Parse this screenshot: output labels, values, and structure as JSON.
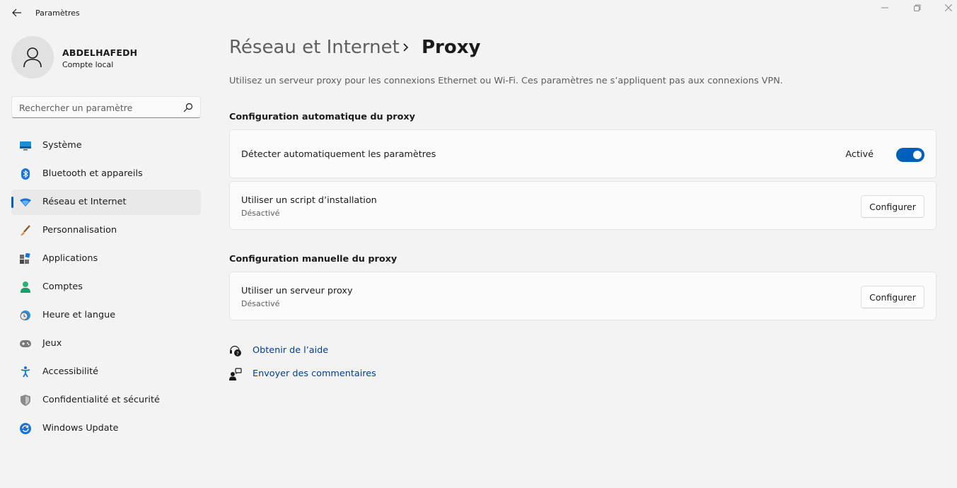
{
  "window": {
    "title": "Paramètres",
    "controls": [
      "minimize-icon",
      "maximize-icon",
      "close-icon"
    ]
  },
  "user": {
    "name": "ABDELHAFEDH",
    "account_type": "Compte local"
  },
  "search": {
    "placeholder": "Rechercher un paramètre"
  },
  "sidebar": {
    "items": [
      {
        "label": "Système",
        "icon": "monitor-icon",
        "selected": false
      },
      {
        "label": "Bluetooth et appareils",
        "icon": "bluetooth-icon",
        "selected": false
      },
      {
        "label": "Réseau et Internet",
        "icon": "wifi-icon",
        "selected": true
      },
      {
        "label": "Personnalisation",
        "icon": "brush-icon",
        "selected": false
      },
      {
        "label": "Applications",
        "icon": "apps-icon",
        "selected": false
      },
      {
        "label": "Comptes",
        "icon": "person-icon",
        "selected": false
      },
      {
        "label": "Heure et langue",
        "icon": "clock-globe-icon",
        "selected": false
      },
      {
        "label": "Jeux",
        "icon": "gamepad-icon",
        "selected": false
      },
      {
        "label": "Accessibilité",
        "icon": "accessibility-icon",
        "selected": false
      },
      {
        "label": "Confidentialité et sécurité",
        "icon": "shield-icon",
        "selected": false
      },
      {
        "label": "Windows Update",
        "icon": "update-icon",
        "selected": false
      }
    ]
  },
  "breadcrumb": {
    "parent": "Réseau et Internet",
    "current": "Proxy"
  },
  "description": "Utilisez un serveur proxy pour les connexions Ethernet ou Wi-Fi. Ces paramètres ne s’appliquent pas aux connexions VPN.",
  "auto_section": {
    "title": "Configuration automatique du proxy",
    "detect": {
      "label": "Détecter automatiquement les paramètres",
      "state_label": "Activé",
      "on": true
    },
    "script": {
      "label": "Utiliser un script d’installation",
      "status": "Désactivé",
      "button": "Configurer"
    }
  },
  "manual_section": {
    "title": "Configuration manuelle du proxy",
    "proxy": {
      "label": "Utiliser un serveur proxy",
      "status": "Désactivé",
      "button": "Configurer"
    }
  },
  "links": {
    "help": "Obtenir de l’aide",
    "feedback": "Envoyer des commentaires"
  },
  "colors": {
    "accent": "#005fb8",
    "link": "#003e92",
    "background": "#f3f3f3",
    "card": "#fbfbfb"
  }
}
